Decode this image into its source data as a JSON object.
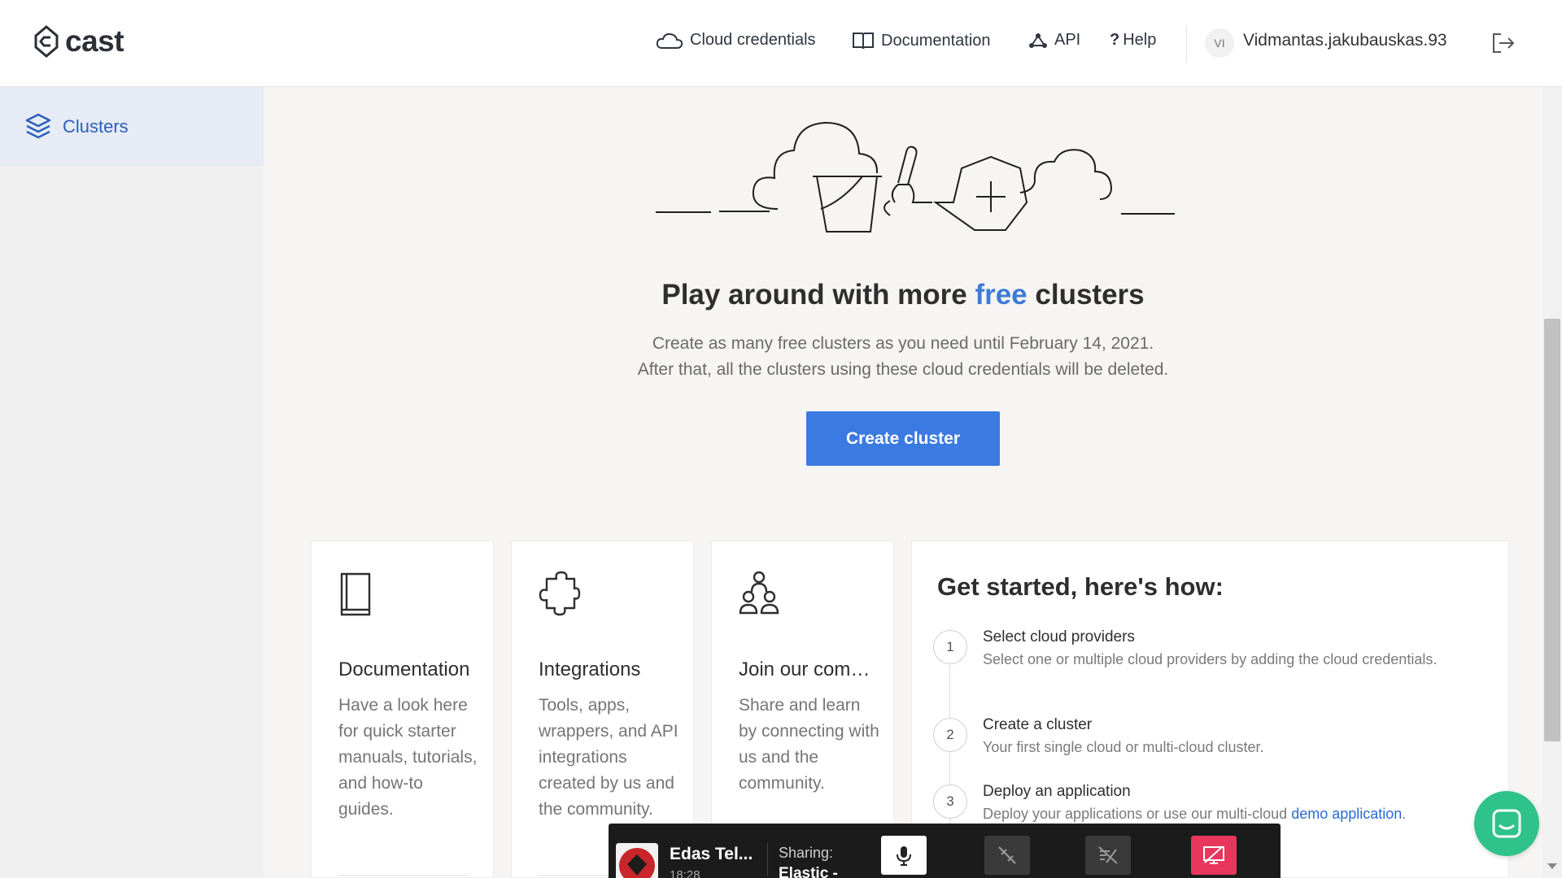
{
  "header": {
    "logo_text": "cast",
    "nav": {
      "cloud_credentials": "Cloud credentials",
      "documentation": "Documentation",
      "api": "API",
      "help": "Help"
    },
    "avatar_initials": "VI",
    "username": "Vidmantas.jakubauskas.93"
  },
  "sidebar": {
    "items": [
      {
        "label": "Clusters",
        "icon": "layers-icon",
        "active": true
      }
    ]
  },
  "hero": {
    "title_before": "Play around with more ",
    "title_accent": "free",
    "title_after": " clusters",
    "subtitle_line1": "Create as many free clusters as you need until February 14, 2021.",
    "subtitle_line2": "After that, all the clusters using these cloud credentials will be deleted.",
    "create_button": "Create cluster"
  },
  "cards": [
    {
      "title": "Documentation",
      "text": "Have a look here for quick starter manuals, tutorials, and how-to guides.",
      "icon": "book-icon"
    },
    {
      "title": "Integrations",
      "text": "Tools, apps, wrappers, and API integrations created by us and the community.",
      "icon": "puzzle-icon"
    },
    {
      "title": "Join our community",
      "text": "Share and learn by connecting with us and the community.",
      "icon": "community-icon"
    }
  ],
  "get_started": {
    "title": "Get started, here's how:",
    "steps": [
      {
        "num": "1",
        "title": "Select cloud providers",
        "text": "Select one or multiple cloud providers by adding the cloud credentials."
      },
      {
        "num": "2",
        "title": "Create a cluster",
        "text": "Your first single cloud or multi-cloud cluster."
      },
      {
        "num": "3",
        "title": "Deploy an application",
        "text_before": "Deploy your applications or use our multi-cloud ",
        "link": "demo application",
        "text_after": "."
      }
    ]
  },
  "share_bar": {
    "name": "Edas Tel...",
    "time": "18:28",
    "sharing_label": "Sharing:",
    "sharing_target": "Elastic -"
  },
  "colors": {
    "accent": "#3b7ae0",
    "sidebar_active": "#e6ebf5",
    "chat": "#2fc28b",
    "stop_share": "#e8365d"
  }
}
